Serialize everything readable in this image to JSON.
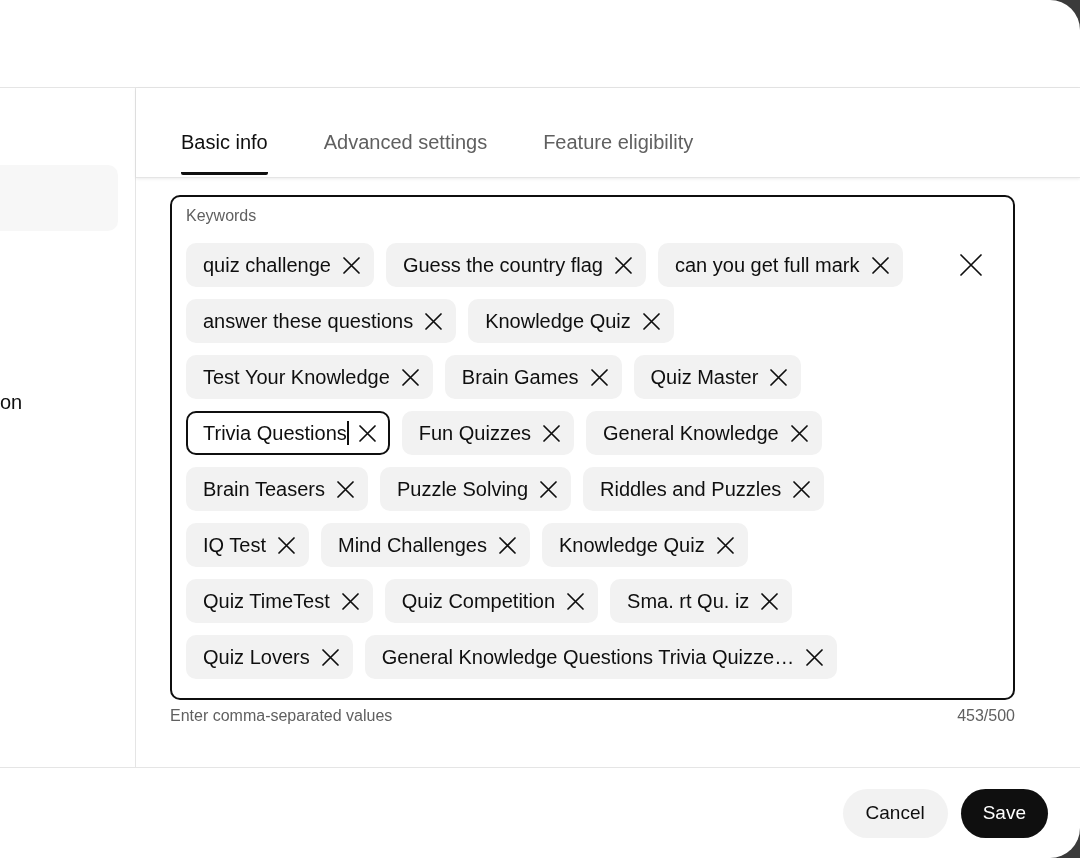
{
  "sidebar": {
    "items": [
      {
        "selected": true
      },
      {
        "label": "on",
        "selected": false
      }
    ]
  },
  "tabs": [
    {
      "label": "Basic info",
      "selected": true
    },
    {
      "label": "Advanced settings",
      "selected": false
    },
    {
      "label": "Feature eligibility",
      "selected": false
    }
  ],
  "keywords": {
    "label": "Keywords",
    "chips": [
      {
        "text": "quiz challenge",
        "editing": false
      },
      {
        "text": "Guess the country flag",
        "editing": false
      },
      {
        "text": "can you get full mark",
        "editing": false
      },
      {
        "text": "answer these questions",
        "editing": false
      },
      {
        "text": "Knowledge Quiz",
        "editing": false
      },
      {
        "text": "Test Your Knowledge",
        "editing": false
      },
      {
        "text": "Brain Games",
        "editing": false
      },
      {
        "text": "Quiz Master",
        "editing": false
      },
      {
        "text": "Trivia Questions",
        "editing": true
      },
      {
        "text": "Fun Quizzes",
        "editing": false
      },
      {
        "text": "General Knowledge",
        "editing": false
      },
      {
        "text": "Brain Teasers",
        "editing": false
      },
      {
        "text": "Puzzle Solving",
        "editing": false
      },
      {
        "text": "Riddles and Puzzles",
        "editing": false
      },
      {
        "text": "IQ Test",
        "editing": false
      },
      {
        "text": "Mind Challenges",
        "editing": false
      },
      {
        "text": "Knowledge Quiz",
        "editing": false
      },
      {
        "text": "Quiz TimeTest",
        "editing": false
      },
      {
        "text": "Quiz Competition",
        "editing": false
      },
      {
        "text": "Sma. rt Qu. iz",
        "editing": false
      },
      {
        "text": "Quiz Lovers",
        "editing": false
      },
      {
        "text": "General Knowledge Questions Trivia Quizze…",
        "editing": false
      }
    ],
    "helper": "Enter comma-separated values",
    "count": "453/500"
  },
  "buttons": [
    {
      "label": "Cancel",
      "kind": "secondary"
    },
    {
      "label": "Save",
      "kind": "primary"
    }
  ]
}
